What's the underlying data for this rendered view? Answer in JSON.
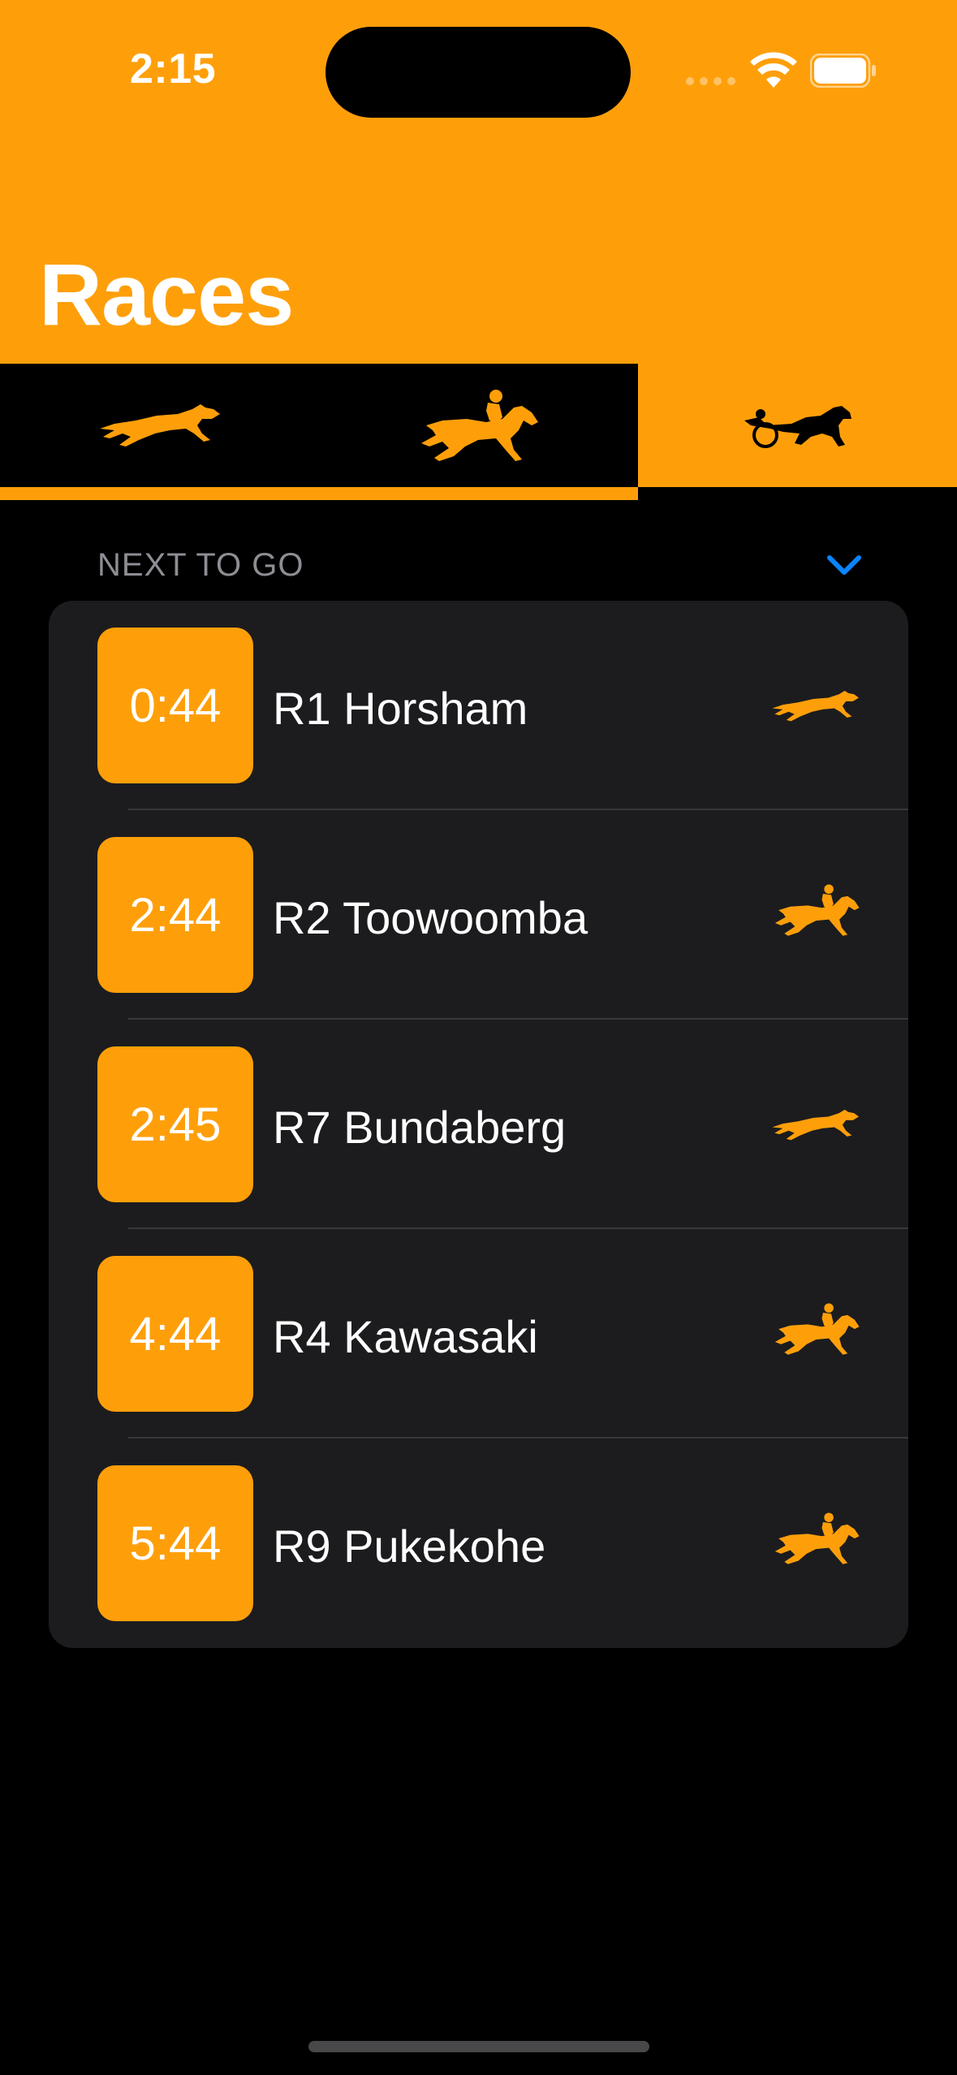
{
  "status_bar": {
    "time": "2:15"
  },
  "header": {
    "title": "Races"
  },
  "colors": {
    "accent": "#FE9F0A",
    "link_blue": "#0A84FF",
    "list_bg": "#1C1C1E",
    "secondary_text": "#8D8D93"
  },
  "tabs": [
    {
      "icon": "greyhound-icon",
      "selected": true
    },
    {
      "icon": "horse-racing-icon",
      "selected": true
    },
    {
      "icon": "harness-racing-icon",
      "selected": false
    }
  ],
  "section": {
    "title": "NEXT TO GO",
    "expanded": true
  },
  "races": [
    {
      "countdown": "0:44",
      "name": "R1 Horsham",
      "category_icon": "greyhound-icon"
    },
    {
      "countdown": "2:44",
      "name": "R2 Toowoomba",
      "category_icon": "horse-racing-icon"
    },
    {
      "countdown": "2:45",
      "name": "R7 Bundaberg",
      "category_icon": "greyhound-icon"
    },
    {
      "countdown": "4:44",
      "name": "R4 Kawasaki",
      "category_icon": "horse-racing-icon"
    },
    {
      "countdown": "5:44",
      "name": "R9 Pukekohe",
      "category_icon": "horse-racing-icon"
    }
  ]
}
